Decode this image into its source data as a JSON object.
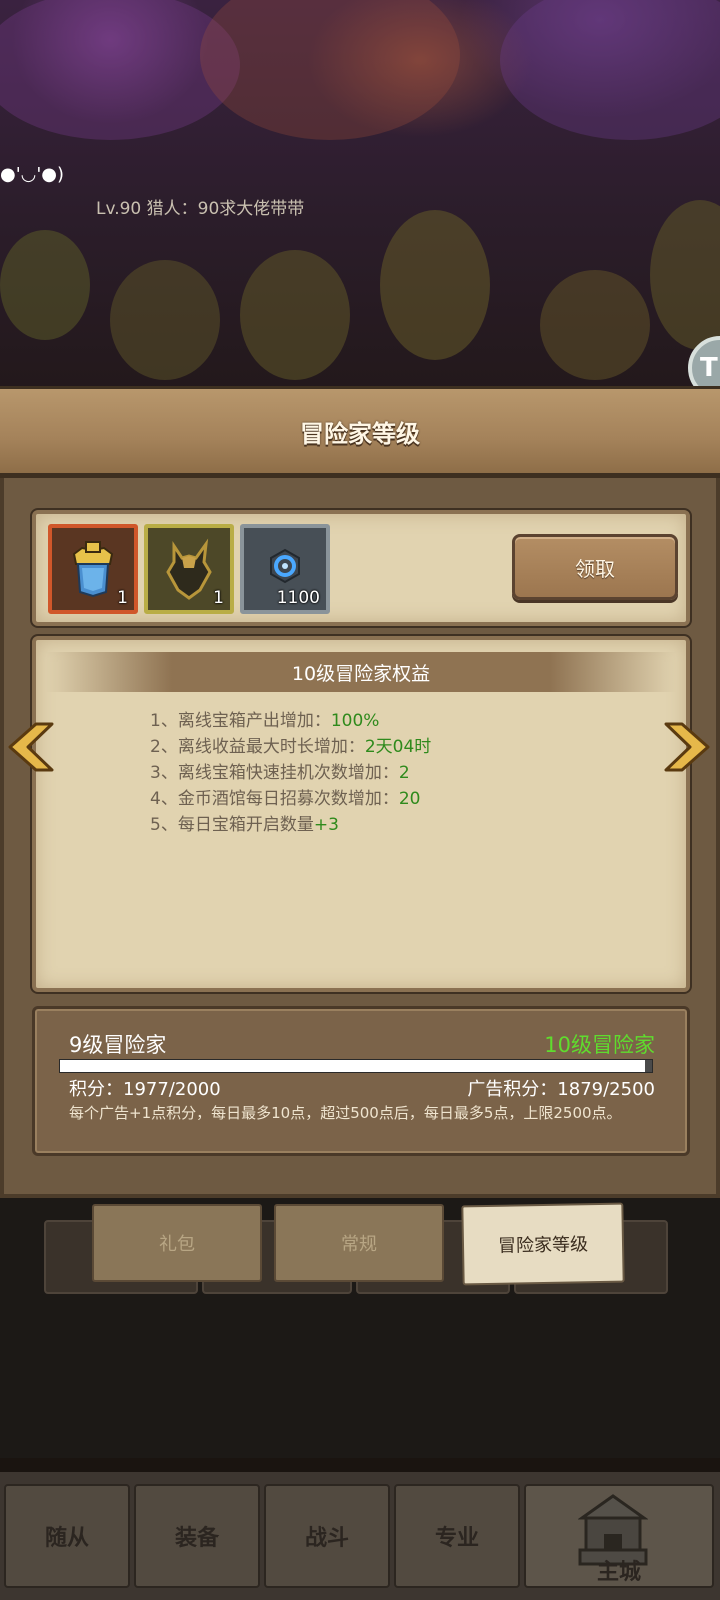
{
  "scene": {
    "player_face": "●'◡'●)",
    "player_info": "Lv.90 猎人：90求大佬带带",
    "badge": "T"
  },
  "panel": {
    "title": "冒险家等级",
    "rewards": [
      {
        "icon": "armor-icon",
        "qty": "1"
      },
      {
        "icon": "shoulder-armor-icon",
        "qty": "1"
      },
      {
        "icon": "blue-gem-icon",
        "qty": "1100"
      }
    ],
    "claim_label": "领取",
    "benefits_title": "10级冒险家权益",
    "benefits": [
      {
        "text": "1、离线宝箱产出增加：",
        "value": "100%"
      },
      {
        "text": "2、离线收益最大时长增加：",
        "value": "2天04时"
      },
      {
        "text": "3、离线宝箱快速挂机次数增加：",
        "value": "2"
      },
      {
        "text": "4、金币酒馆每日招募次数增加：",
        "value": "20"
      },
      {
        "text": "5、每日宝箱开启数量",
        "value": "+3"
      }
    ]
  },
  "progress": {
    "current_level": "9级冒险家",
    "next_level": "10级冒险家",
    "fill_fraction": 0.9885,
    "points": "积分：1977/2000",
    "ad_points": "广告积分：1879/2500",
    "note": "每个广告+1点积分，每日最多10点，超过500点后，每日最多5点，上限2500点。"
  },
  "tabs": [
    "礼包",
    "常规",
    "冒险家等级"
  ],
  "nav": [
    "随从",
    "装备",
    "战斗",
    "专业",
    "主城"
  ],
  "colors": {
    "accent_green": "#5fdc2e",
    "value_green": "#2f8a1c",
    "parchment": "#e1d3b0",
    "wood": "#a4825a"
  }
}
